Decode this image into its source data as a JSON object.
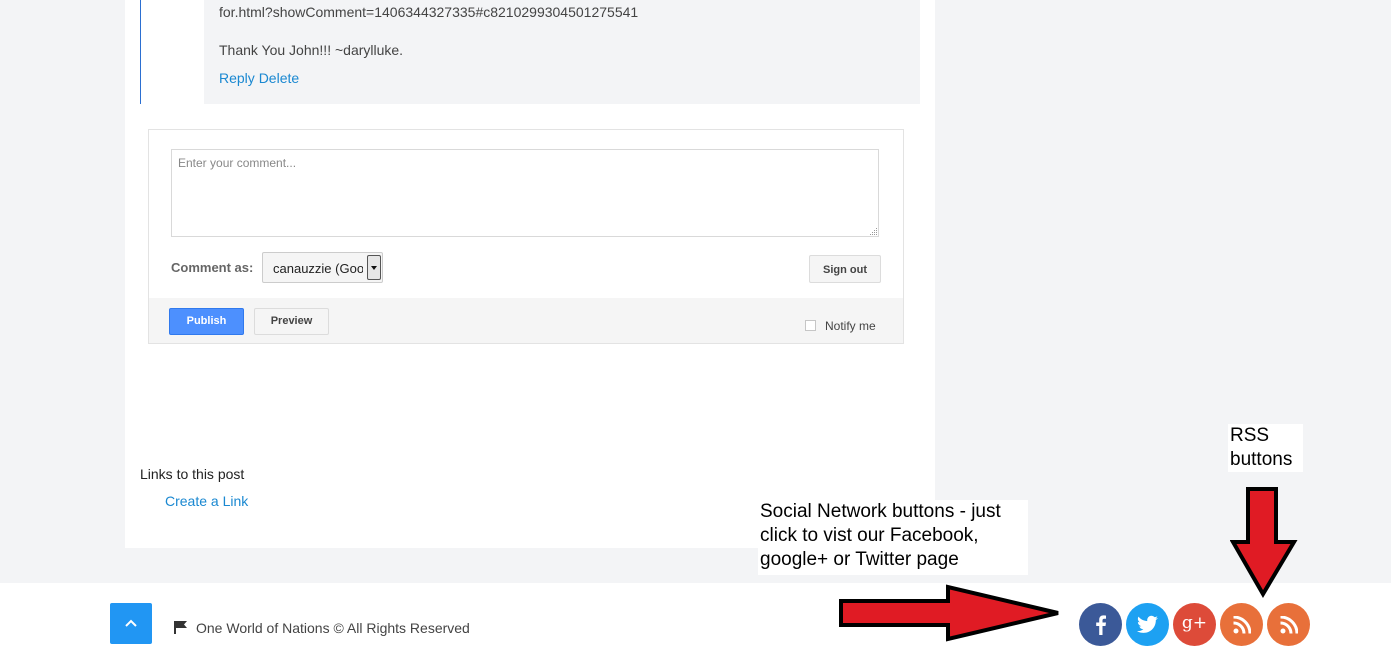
{
  "reply": {
    "url_text": "for.html?showComment=1406344327335#c8210299304501275541",
    "text": "Thank You John!!! ~darylluke.",
    "reply_link": "Reply",
    "delete_link": "Delete"
  },
  "comment_form": {
    "placeholder": "Enter your comment...",
    "comment_as_label": "Comment as:",
    "identity_value": "canauzzie (Goo",
    "sign_out_label": "Sign out",
    "publish_label": "Publish",
    "preview_label": "Preview",
    "notify_label": "Notify me",
    "notify_checked": false
  },
  "links": {
    "heading": "Links to this post",
    "create_link": "Create a Link"
  },
  "footer": {
    "copyright": "One World of Nations © All Rights Reserved"
  },
  "social": {
    "buttons": [
      {
        "name": "facebook",
        "color": "#3b5998",
        "icon": "facebook-icon"
      },
      {
        "name": "twitter",
        "color": "#1da1f2",
        "icon": "twitter-icon"
      },
      {
        "name": "google-plus",
        "color": "#dd4b39",
        "glyph": "g+",
        "icon": "google-plus-icon"
      },
      {
        "name": "rss-1",
        "color": "#e8703a",
        "icon": "rss-icon"
      },
      {
        "name": "rss-2",
        "color": "#e8703a",
        "icon": "rss-icon"
      }
    ]
  },
  "annotations": {
    "social_note": [
      "Social Network buttons - just",
      "click to vist our Facebook,",
      "google+ or Twitter page"
    ],
    "rss_note": [
      "RSS",
      "buttons"
    ]
  },
  "colors": {
    "link": "#1a88d1",
    "publish": "#4d90fe",
    "back_to_top": "#2196f3",
    "arrow": "#e01b24"
  }
}
